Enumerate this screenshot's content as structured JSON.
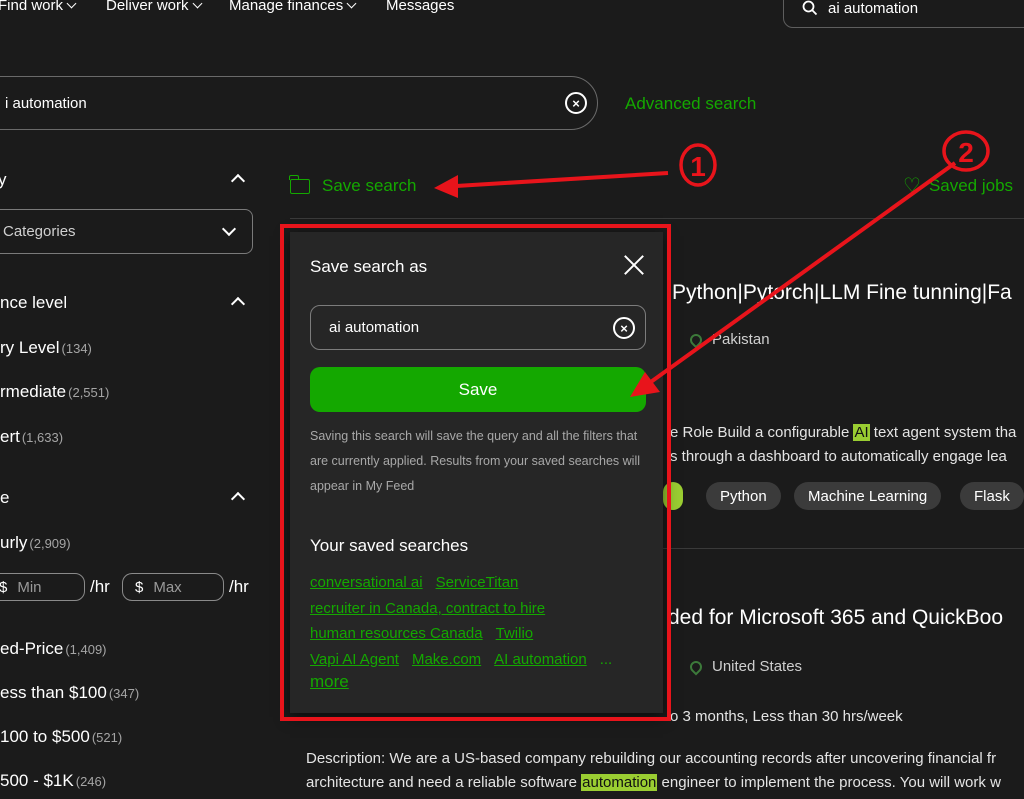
{
  "nav": {
    "items": [
      {
        "label": "Find work"
      },
      {
        "label": "Deliver work"
      },
      {
        "label": "Manage finances"
      },
      {
        "label": "Messages"
      }
    ],
    "search_value": "ai automation"
  },
  "main_search": {
    "value": "i automation",
    "advanced_label": "Advanced search"
  },
  "sidebar": {
    "category_heading": "y",
    "category_select": "Categories",
    "experience_heading": "nce level",
    "experience": [
      {
        "label": "ry Level",
        "count": "(134)"
      },
      {
        "label": "rmediate",
        "count": "(2,551)"
      },
      {
        "label": "ert",
        "count": "(1,633)"
      }
    ],
    "type_heading": "e",
    "hourly": {
      "label": "urly",
      "count": "(2,909)"
    },
    "rate": {
      "currency": "$",
      "min": "Min",
      "max": "Max",
      "unit": "/hr"
    },
    "fixed": {
      "label": "ed-Price",
      "count": "(1,409)"
    },
    "budgets": [
      {
        "label": "ess than $100",
        "count": "(347)"
      },
      {
        "label": "100 to $500",
        "count": "(521)"
      },
      {
        "label": "500 - $1K",
        "count": "(246)"
      }
    ]
  },
  "feed": {
    "save_search_label": "Save search",
    "saved_jobs_label": "Saved jobs",
    "job1": {
      "title": "Python|Pytorch|LLM Fine tunning|Fa",
      "location": "Pakistan",
      "desc_line1_pre": "e Role Build a configurable ",
      "desc_line1_hl": "AI",
      "desc_line1_post": " text agent system tha",
      "desc_line2": "s through a dashboard to automatically engage lea",
      "tags": [
        "Python",
        "Machine Learning",
        "Flask"
      ]
    },
    "job2": {
      "title": "ded for Microsoft 365 and QuickBoo",
      "location": "United States",
      "meta": "o 3 months, Less than 30 hrs/week",
      "desc_line1": "Description: We are a US-based company rebuilding our accounting records after uncovering financial fr",
      "desc_line2_pre": "architecture and need a reliable software ",
      "desc_line2_hl": "automation",
      "desc_line2_post": " engineer to implement the process. You will work w"
    }
  },
  "modal": {
    "title": "Save search as",
    "input_value": "ai automation",
    "save_label": "Save",
    "note": "Saving this search will save the query and all the filters that are currently applied. Results from your saved searches will appear in My Feed",
    "saved_heading": "Your saved searches",
    "saved_rows": [
      [
        "conversational ai",
        "ServiceTitan"
      ],
      [
        "recruiter in Canada, contract to hire"
      ],
      [
        "human resources Canada",
        "Twilio"
      ],
      [
        "Vapi AI Agent",
        "Make.com",
        "AI automation"
      ]
    ],
    "ellipsis": "...",
    "more_label": "more"
  },
  "annotations": {
    "label1": "1",
    "label2": "2",
    "color": "#e8141b"
  },
  "colors": {
    "accent": "#14a800",
    "background": "#1b1b1b",
    "modal": "#262626",
    "annotation": "#e8141b"
  }
}
